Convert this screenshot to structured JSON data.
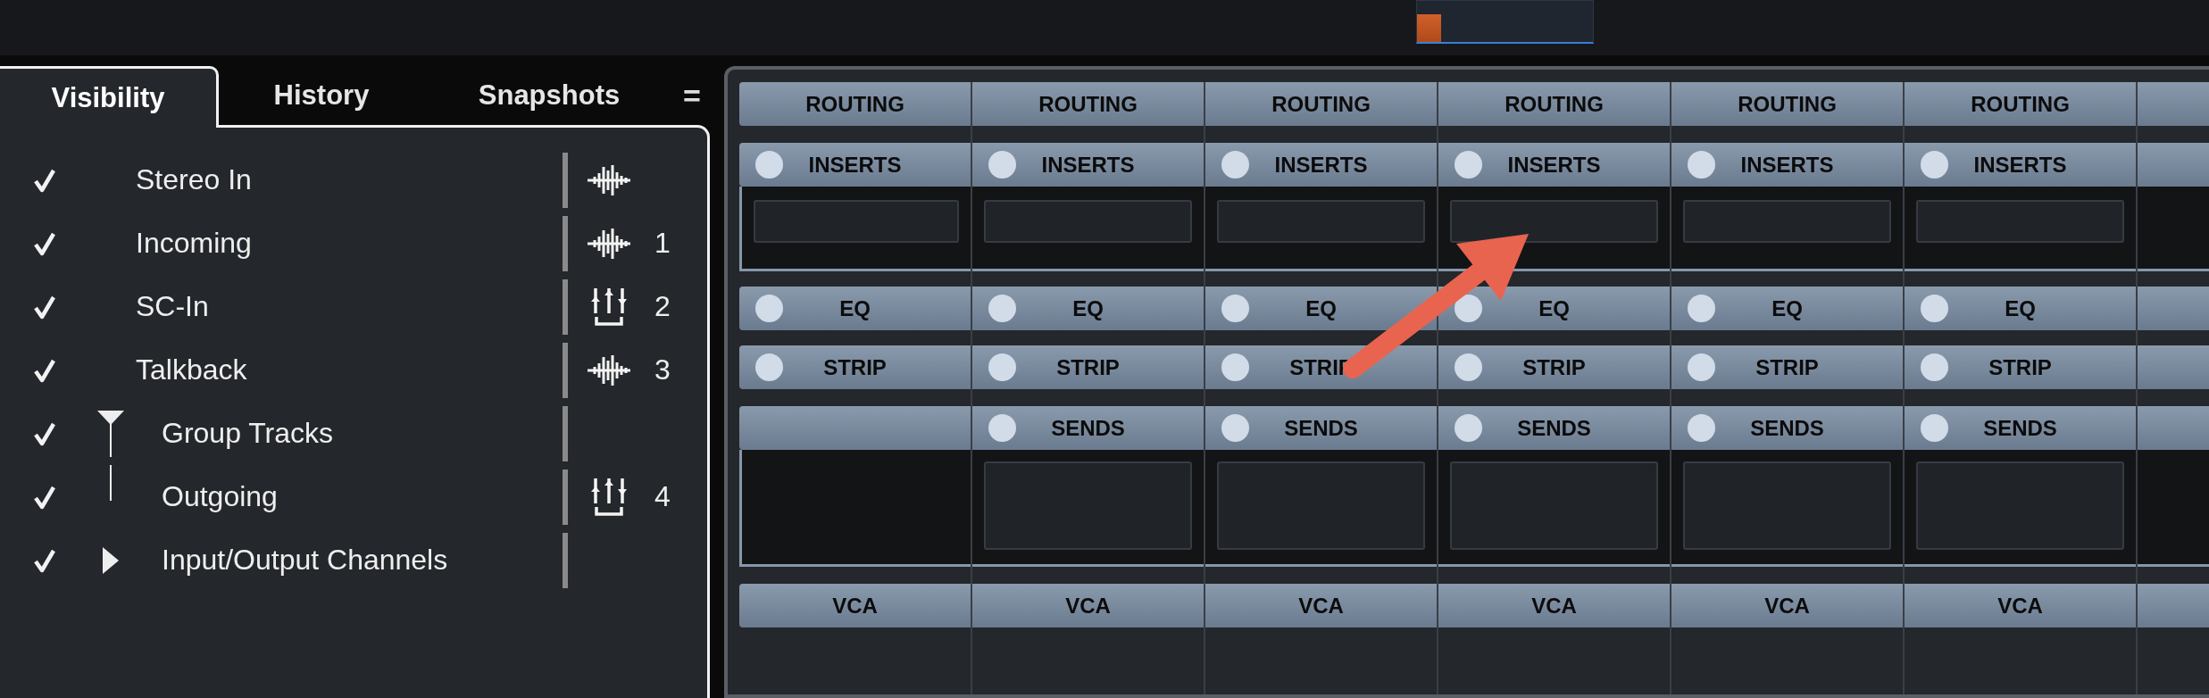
{
  "tabs": [
    {
      "label": "Visibility",
      "selected": true
    },
    {
      "label": "History",
      "selected": false
    },
    {
      "label": "Snapshots",
      "selected": false
    }
  ],
  "menu_button": "=",
  "tracks": [
    {
      "label": "Stereo In",
      "checked": true,
      "kind": "audio"
    },
    {
      "label": "Incoming",
      "checked": true,
      "kind": "audio",
      "number": "1"
    },
    {
      "label": "SC-In",
      "checked": true,
      "kind": "bus",
      "number": "2"
    },
    {
      "label": "Talkback",
      "checked": true,
      "kind": "audio",
      "number": "3"
    },
    {
      "label": "Group Tracks",
      "checked": true,
      "kind": "folder",
      "expanded": true,
      "children": [
        {
          "label": "Outgoing",
          "checked": true,
          "kind": "bus",
          "number": "4"
        }
      ]
    },
    {
      "label": "Input/Output Channels",
      "checked": true,
      "kind": "folder",
      "expanded": false
    }
  ],
  "mixer": {
    "columns": [
      {
        "routing": "ROUTING",
        "inserts": "INSERTS",
        "eq": "EQ",
        "strip": "STRIP",
        "vca": "VCA"
      },
      {
        "routing": "ROUTING",
        "inserts": "INSERTS",
        "eq": "EQ",
        "strip": "STRIP",
        "sends": "SENDS",
        "vca": "VCA"
      },
      {
        "routing": "ROUTING",
        "inserts": "INSERTS",
        "eq": "EQ",
        "strip": "STRIP",
        "sends": "SENDS",
        "vca": "VCA"
      },
      {
        "routing": "ROUTING",
        "inserts": "INSERTS",
        "eq": "EQ",
        "strip": "STRIP",
        "sends": "SENDS",
        "vca": "VCA"
      },
      {
        "routing": "ROUTING",
        "inserts": "INSERTS",
        "eq": "EQ",
        "strip": "STRIP",
        "sends": "SENDS",
        "vca": "VCA"
      },
      {
        "routing": "ROUTING",
        "inserts": "INSERTS",
        "eq": "EQ",
        "strip": "STRIP",
        "sends": "SENDS",
        "vca": "VCA"
      }
    ]
  }
}
